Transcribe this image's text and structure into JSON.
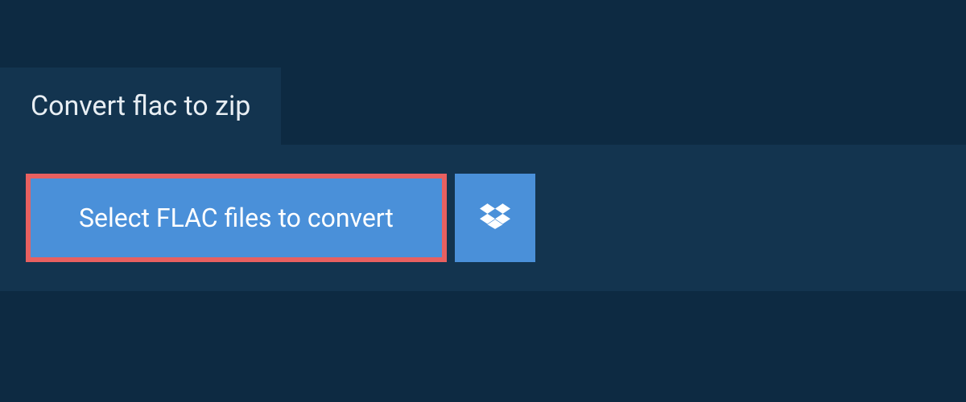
{
  "tab": {
    "title": "Convert flac to zip"
  },
  "upload": {
    "select_label": "Select FLAC files to convert"
  },
  "colors": {
    "page_bg": "#0d2a42",
    "panel_bg": "#13344f",
    "accent": "#4a90d9",
    "highlight_border": "#e86060",
    "text_light": "#ffffff"
  }
}
